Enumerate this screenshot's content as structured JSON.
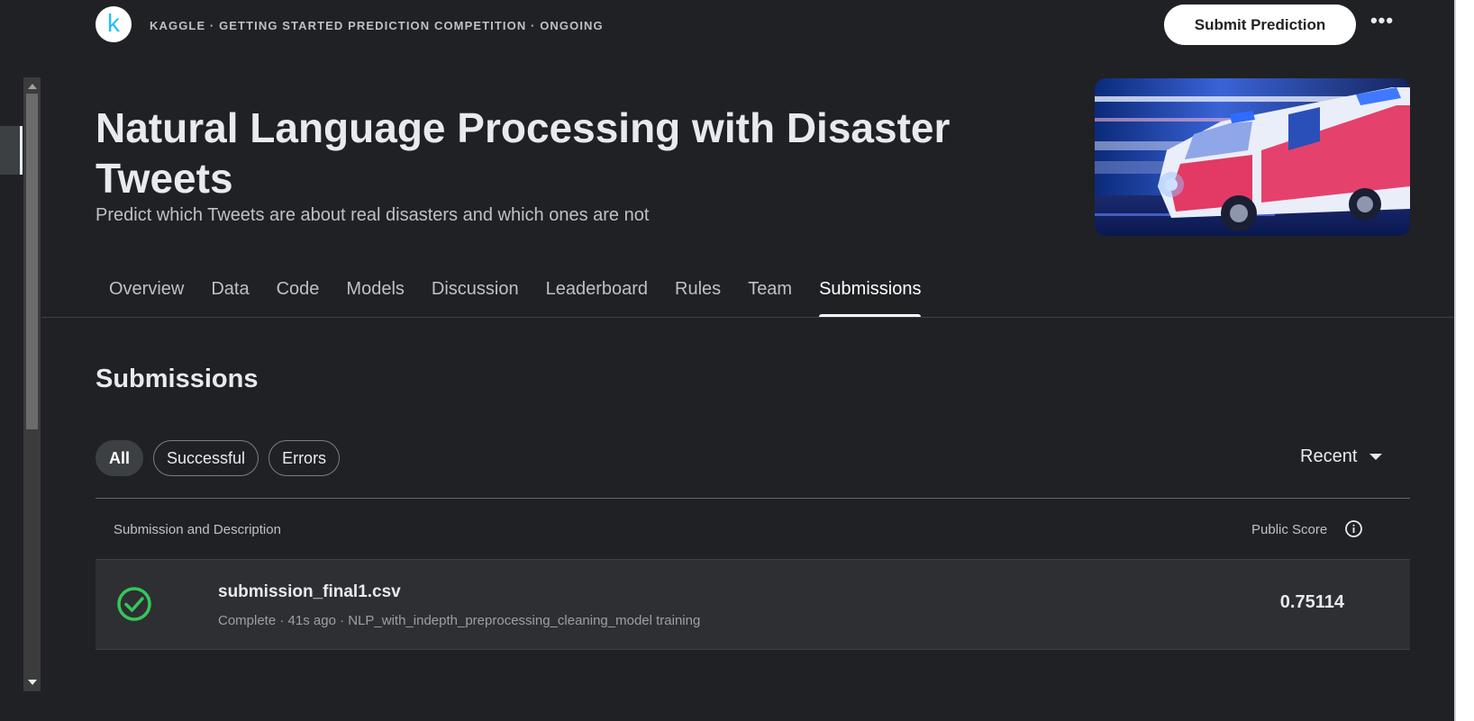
{
  "header": {
    "logo_letter": "k",
    "breadcrumb": "KAGGLE · GETTING STARTED PREDICTION COMPETITION · ONGOING",
    "submit_label": "Submit Prediction",
    "more_label": "•••"
  },
  "competition": {
    "title": "Natural Language Processing with Disaster Tweets",
    "subtitle": "Predict which Tweets are about real disasters and which ones are not"
  },
  "tabs": [
    {
      "label": "Overview"
    },
    {
      "label": "Data"
    },
    {
      "label": "Code"
    },
    {
      "label": "Models"
    },
    {
      "label": "Discussion"
    },
    {
      "label": "Leaderboard"
    },
    {
      "label": "Rules"
    },
    {
      "label": "Team"
    },
    {
      "label": "Submissions",
      "active": true
    }
  ],
  "submissions": {
    "title": "Submissions",
    "filters": [
      "All",
      "Successful",
      "Errors"
    ],
    "active_filter": "All",
    "sort_label": "Recent",
    "columns": {
      "left": "Submission and Description",
      "right": "Public Score"
    },
    "rows": [
      {
        "file": "submission_final1.csv",
        "status": "Complete",
        "meta": "Complete · 41s ago · NLP_with_indepth_preprocessing_cleaning_model training",
        "score": "0.75114",
        "status_icon": "check-circle-icon"
      }
    ]
  },
  "colors": {
    "background": "#202124",
    "row_background": "#2e2f33",
    "success": "#34c759",
    "brand": "#20beff"
  }
}
